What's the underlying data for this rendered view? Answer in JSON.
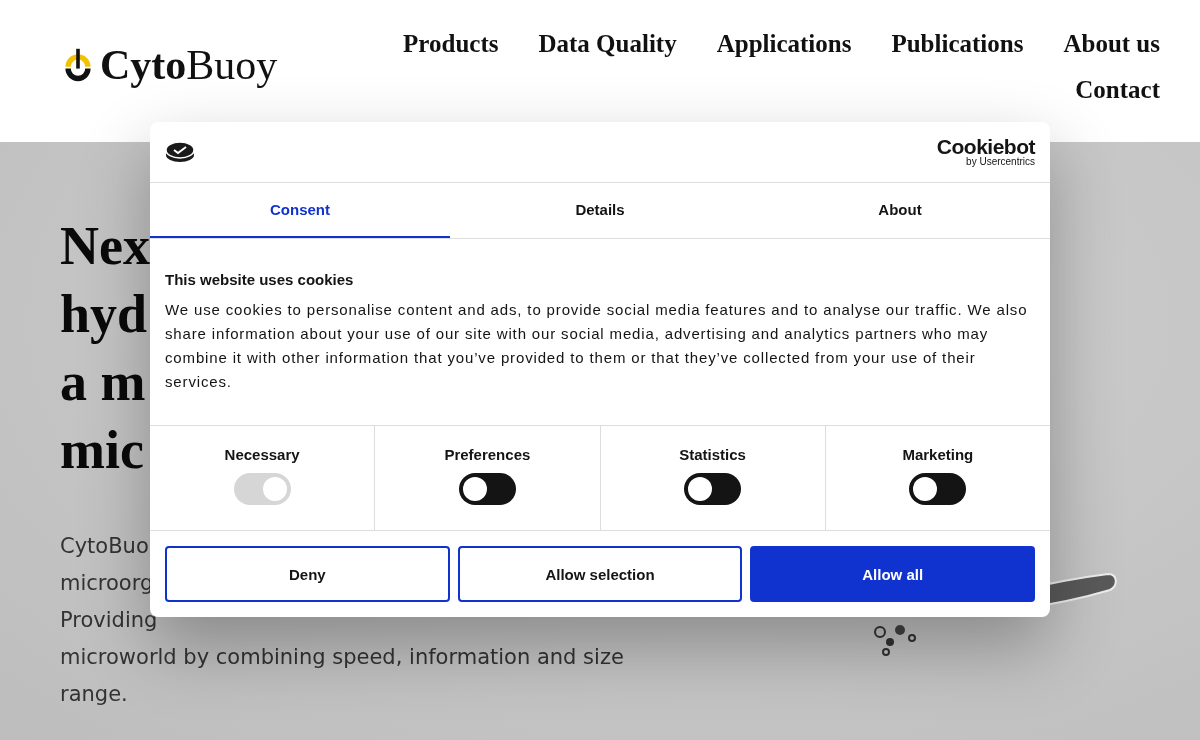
{
  "header": {
    "logo": "**Cyto**Buoy",
    "nav": [
      {
        "label": "Products"
      },
      {
        "label": "Data Quality"
      },
      {
        "label": "Applications"
      },
      {
        "label": "Publications"
      },
      {
        "label": "About us"
      },
      {
        "label": "Contact"
      }
    ]
  },
  "hero": {
    "heading_lines": [
      "Nex",
      "hyd",
      "a m",
      "mic"
    ],
    "text_lines": [
      "CytoBuo",
      "microorg",
      "Providing",
      "microworld by combining speed, information and size",
      "range."
    ]
  },
  "cookie_dialog": {
    "brand": "Cookiebot",
    "brand_sub": "by Usercentrics",
    "tabs": [
      {
        "label": "Consent",
        "selected": true
      },
      {
        "label": "Details",
        "selected": false
      },
      {
        "label": "About",
        "selected": false
      }
    ],
    "title": "This website uses cookies",
    "text": "We use cookies to personalise content and ads, to provide social media features and to analyse our traffic. We also share information about your use of our site with our social media, advertising and analytics partners who may combine it with other information that you’ve provided to them or that they’ve collected from your use of their services.",
    "toggles": [
      {
        "label": "Necessary",
        "on": true,
        "disabled": true
      },
      {
        "label": "Preferences",
        "on": false,
        "disabled": false
      },
      {
        "label": "Statistics",
        "on": false,
        "disabled": false
      },
      {
        "label": "Marketing",
        "on": false,
        "disabled": false
      }
    ],
    "buttons": [
      {
        "label": "Deny",
        "kind": "outline"
      },
      {
        "label": "Allow selection",
        "kind": "outline"
      },
      {
        "label": "Allow all",
        "kind": "primary"
      }
    ]
  }
}
